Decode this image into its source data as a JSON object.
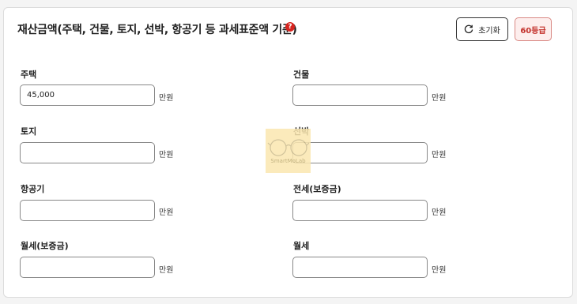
{
  "header": {
    "title": "재산금액(주택, 건물, 토지, 선박, 항공기 등 과세표준액 기준)",
    "help_icon": "?",
    "reset_label": "초기화",
    "grade_label": "60등급"
  },
  "fields": [
    {
      "label": "주택",
      "value": "45,000",
      "unit": "만원"
    },
    {
      "label": "건물",
      "value": "",
      "unit": "만원"
    },
    {
      "label": "토지",
      "value": "",
      "unit": "만원"
    },
    {
      "label": "선박",
      "value": "",
      "unit": "만원"
    },
    {
      "label": "항공기",
      "value": "",
      "unit": "만원"
    },
    {
      "label": "전세(보증금)",
      "value": "",
      "unit": "만원"
    },
    {
      "label": "월세(보증금)",
      "value": "",
      "unit": "만원"
    },
    {
      "label": "월세",
      "value": "",
      "unit": "만원"
    }
  ],
  "watermark": {
    "text": "SmartMoLab"
  },
  "colors": {
    "accent": "#d6251f",
    "badge_bg": "#fdeeed",
    "badge_text": "#c3302a"
  }
}
